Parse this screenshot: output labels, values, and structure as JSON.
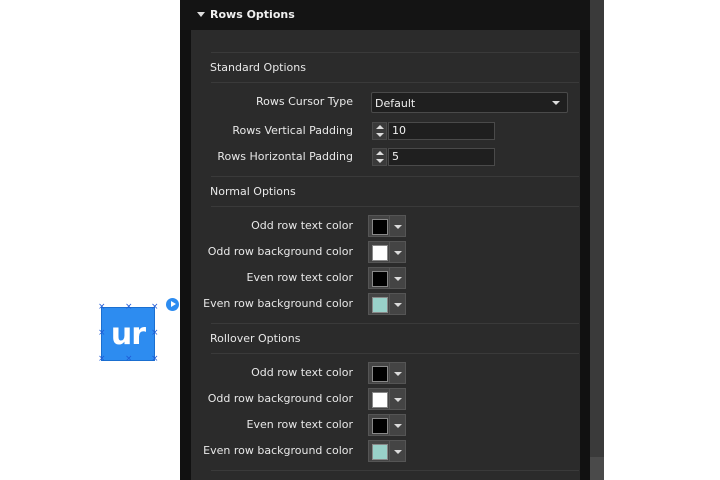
{
  "widget": {
    "text": "ur",
    "handle_glyph": "×"
  },
  "panel": {
    "title": "Rows Options",
    "standard": {
      "title": "Standard Options",
      "cursor_label": "Rows Cursor Type",
      "cursor_value": "Default",
      "vpad_label": "Rows Vertical Padding",
      "vpad_value": "10",
      "hpad_label": "Rows Horizontal Padding",
      "hpad_value": "5"
    },
    "normal": {
      "title": "Normal Options",
      "rows": [
        {
          "label": "Odd row text color",
          "color": "#000000"
        },
        {
          "label": "Odd row background color",
          "color": "#ffffff"
        },
        {
          "label": "Even row text color",
          "color": "#000000"
        },
        {
          "label": "Even row background color",
          "color": "#99d1c9"
        }
      ]
    },
    "rollover": {
      "title": "Rollover Options",
      "rows": [
        {
          "label": "Odd row text color",
          "color": "#000000"
        },
        {
          "label": "Odd row background color",
          "color": "#ffffff"
        },
        {
          "label": "Even row text color",
          "color": "#000000"
        },
        {
          "label": "Even row background color",
          "color": "#99d1c9"
        }
      ]
    }
  }
}
